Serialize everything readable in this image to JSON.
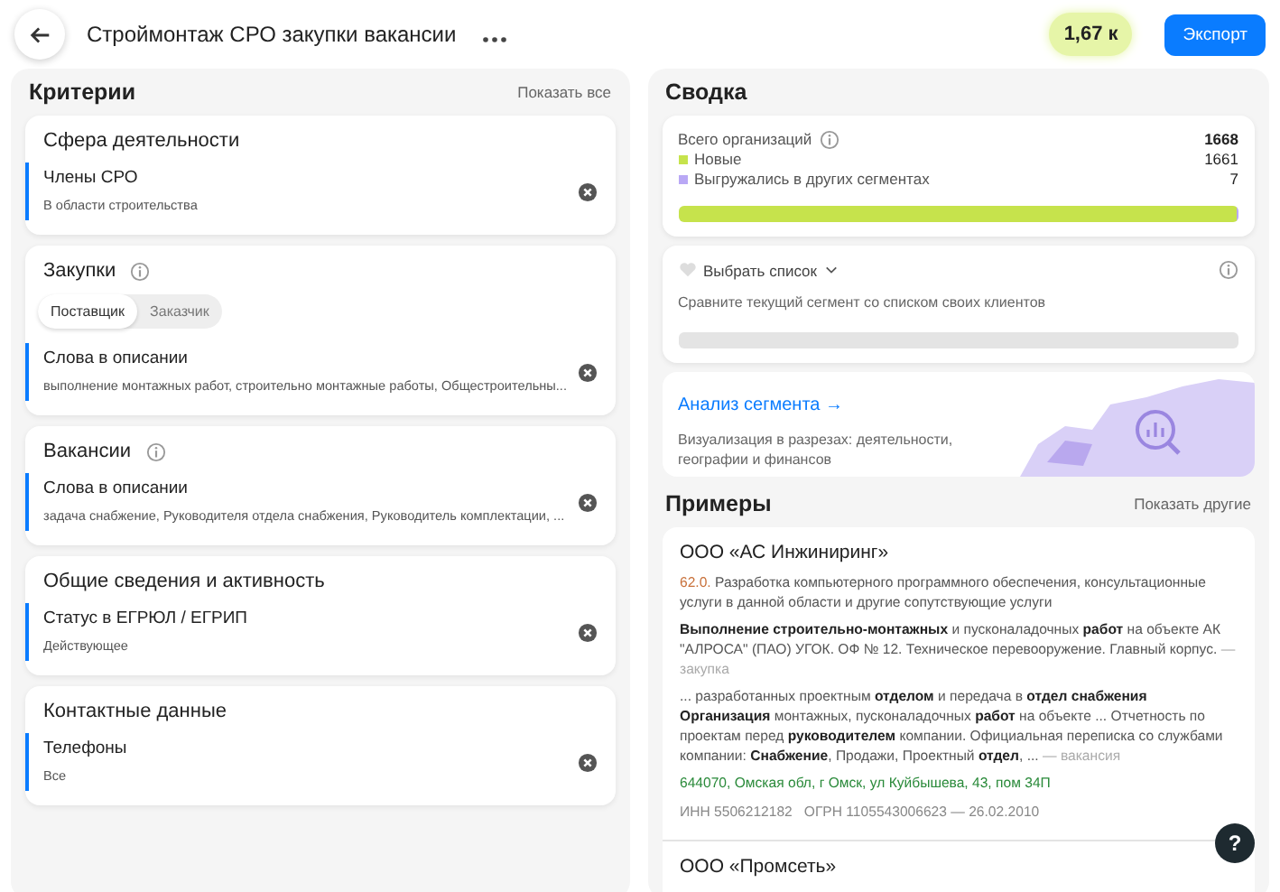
{
  "header": {
    "title": "Строймонтаж СРО закупки вакансии",
    "count": "1,67 к",
    "export_button": "Экспорт"
  },
  "criteria": {
    "title": "Критерии",
    "show_all": "Показать все",
    "cards": [
      {
        "title": "Сфера деятельности",
        "info": false,
        "filters": [
          {
            "name": "Члены СРО",
            "value": "В области строительства"
          }
        ]
      },
      {
        "title": "Закупки",
        "info": true,
        "toggle": [
          {
            "label": "Поставщик",
            "selected": true
          },
          {
            "label": "Заказчик",
            "selected": false
          }
        ],
        "filters": [
          {
            "name": "Слова в описании",
            "value": "выполнение монтажных работ, строительно монтажные работы, Общестроительны..."
          }
        ]
      },
      {
        "title": "Вакансии",
        "info": true,
        "filters": [
          {
            "name": "Слова в описании",
            "value": "задача снабжение, Руководителя отдела снабжения, Руководитель комплектации, ..."
          }
        ]
      },
      {
        "title": "Общие сведения и активность",
        "info": false,
        "filters": [
          {
            "name": "Статус в ЕГРЮЛ / ЕГРИП",
            "value": "Действующее"
          }
        ]
      },
      {
        "title": "Контактные данные",
        "info": false,
        "filters": [
          {
            "name": "Телефоны",
            "value": "Все"
          }
        ]
      }
    ]
  },
  "summary": {
    "title": "Сводка",
    "total_label": "Всего организаций",
    "total": "1668",
    "segments": [
      {
        "label": "Новые",
        "count": "1661",
        "color": "#c6e34c",
        "level": 0.996
      },
      {
        "label": "Выгружались в других сегментах",
        "count": "7",
        "color": "#b9a8f5",
        "level": 0.004
      }
    ],
    "compare": {
      "select": "Выбрать список",
      "hint": "Сравните текущий сегмент со списком своих клиентов"
    },
    "analysis": {
      "link": "Анализ сегмента →",
      "text": "Визуализация в разрезах: деятельности, географии и финансов"
    }
  },
  "examples": {
    "title": "Примеры",
    "show_more": "Показать другие",
    "items": [
      {
        "name": "ООО «АС Инжиниринг»",
        "okved_code": "62.0.",
        "okved_text": "Разработка компьютерного программного обеспечения, консультационные услуги в данной области и другие сопутствующие услуги",
        "snippets": [
          {
            "text": "**Выполнение строительно-монтажных** и пусконаладочных **работ** на объекте АК \"АЛРОСА\" (ПАО) УГОК. ОФ № 12. Техническое перевооружение. Главный корпус.",
            "source": "— закупка"
          },
          {
            "text": "... разработанных проектным **отделом** и передача в **отдел снабжения** **Организация** монтажных, пусконаладочных **работ** на объекте ... Отчетность по проектам перед **руководителем** компании. Официальная переписка со службами компании: **Снабжение**, Продажи, Проектный **отдел**, ...",
            "source": "— вакансия"
          }
        ],
        "address": "644070, Омская обл, г Омск, ул Куйбышева, 43, пом 34П",
        "registry": "ИНН 5506212182   ОГРН 1105543006623 — 26.02.2010"
      },
      {
        "name": "ООО «Промсеть»"
      }
    ]
  },
  "help_button": "?"
}
